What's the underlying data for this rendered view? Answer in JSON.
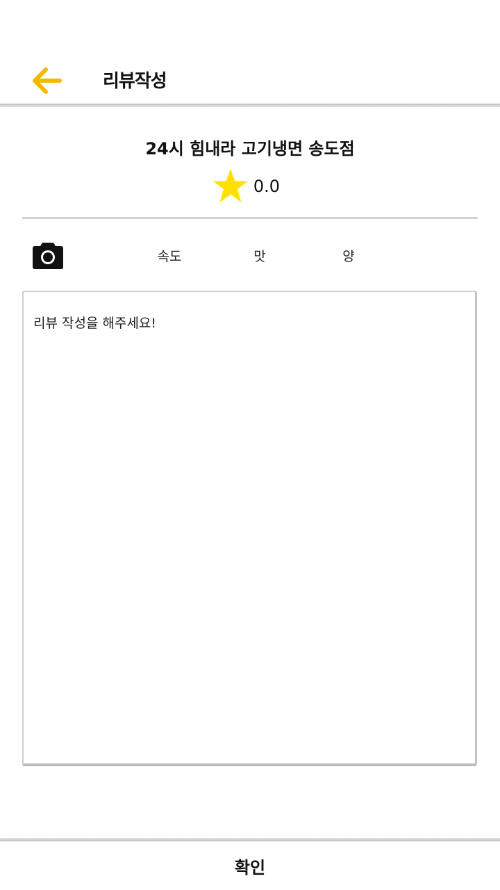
{
  "header": {
    "title": "리뷰작성",
    "back_icon": "arrow-left-icon",
    "back_color": "#F5B800"
  },
  "restaurant": {
    "name": "24시 힘내라 고기냉면 송도점",
    "rating": "0.0",
    "star_icon": "star-icon",
    "star_color": "#FFE000"
  },
  "options": {
    "camera_icon": "camera-icon",
    "tags": [
      "속도",
      "맛",
      "양"
    ]
  },
  "review": {
    "placeholder": "리뷰 작성을 해주세요!",
    "value": ""
  },
  "footer": {
    "confirm_label": "확인"
  }
}
